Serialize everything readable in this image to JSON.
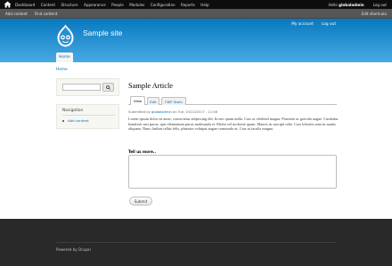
{
  "toolbar": {
    "home_icon": "home-icon",
    "menu": [
      "Dashboard",
      "Content",
      "Structure",
      "Appearance",
      "People",
      "Modules",
      "Configuration",
      "Reports",
      "Help"
    ],
    "hello_prefix": "Hello",
    "username": "globaladmin",
    "logout": "Log out"
  },
  "shortcuts": {
    "items": [
      "Add content",
      "Find content"
    ],
    "edit": "Edit shortcuts"
  },
  "header": {
    "logo_icon": "drupal-drop-icon",
    "site_name": "Sample site",
    "secondary_menu": [
      "My account",
      "Log out"
    ],
    "primary_tab": "Home",
    "colors": {
      "gradient_top": "#0779bf",
      "gradient_bottom": "#48a9e4"
    }
  },
  "breadcrumb": "Home",
  "sidebar": {
    "search_button_icon": "search-icon",
    "navigation_title": "Navigation",
    "navigation_items": [
      "Add content"
    ]
  },
  "main": {
    "title": "Sample Article",
    "tabs": [
      "View",
      "Edit",
      "FWF Stats"
    ],
    "active_tab": "View",
    "submitted_prefix": "Submitted by",
    "submitted_user": "globaladmin",
    "submitted_suffix": "on Tue, 03/22/2017 - 11:08",
    "body": "Lorem ipsum dolor sit amet, consectetur adipiscing elit. In nec quam nulla. Cras ac eleifend magna. Praesent ac gravida augue. Curabitur hendrerit nisi purus, quis elementum purus malesuada et. Morbi vel molestie quam. Mauris in suscipit odio. Cras lobortis urna in mattis aliquam. Nunc finibus tellus felis, pharetra volutpat augue commodo ut. Cras ut iaculis magna.",
    "comment_label": "Tell us more..",
    "comment_value": "",
    "submit_label": "Submit"
  },
  "footer": {
    "powered_by": "Powered by Drupal"
  }
}
